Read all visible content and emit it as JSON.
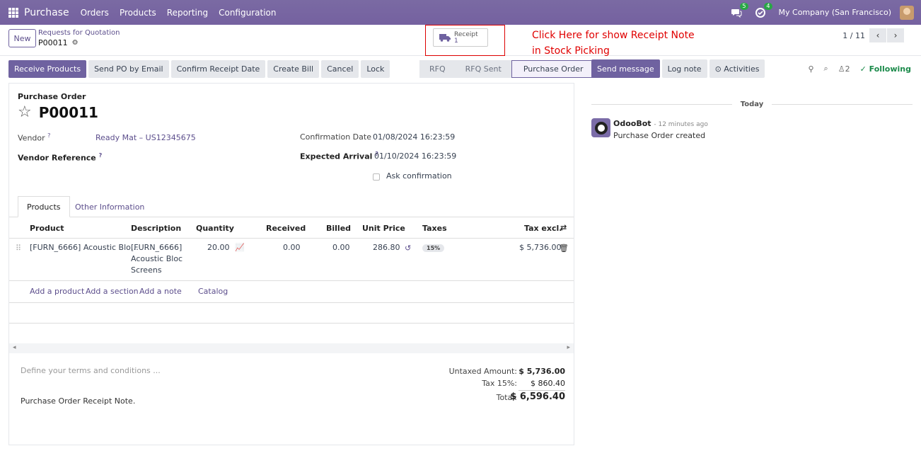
{
  "navbar": {
    "app_name": "Purchase",
    "menus": [
      "Orders",
      "Products",
      "Reporting",
      "Configuration"
    ],
    "messages_count": "5",
    "activities_count": "4",
    "company": "My Company (San Francisco)"
  },
  "control": {
    "new_label": "New",
    "breadcrumb_parent": "Requests for Quotation",
    "breadcrumb_current": "P00011",
    "receipt_label": "Receipt",
    "receipt_count": "1",
    "annotation_line1": "Click Here for show Receipt Note",
    "annotation_line2": "in Stock Picking",
    "pager": "1 / 11"
  },
  "actions": [
    "Receive Products",
    "Send PO by Email",
    "Confirm Receipt Date",
    "Create Bill",
    "Cancel",
    "Lock"
  ],
  "status_steps": [
    "RFQ",
    "RFQ Sent",
    "Purchase Order"
  ],
  "status_active": "Purchase Order",
  "chatter": {
    "send_message": "Send message",
    "log_note": "Log note",
    "activities": "Activities",
    "followers_count": "2",
    "following": "Following",
    "today": "Today",
    "author": "OdooBot",
    "when": "- 12 minutes ago",
    "message": "Purchase Order created"
  },
  "form": {
    "doc_type": "Purchase Order",
    "name": "P00011",
    "vendor_label": "Vendor",
    "vendor_value": "Ready Mat – US12345675",
    "vendor_ref_label": "Vendor Reference",
    "confirmation_label": "Confirmation Date",
    "confirmation_value": "01/08/2024 16:23:59",
    "expected_label": "Expected Arrival",
    "expected_value": "01/10/2024 16:23:59",
    "ask_confirmation": "Ask confirmation",
    "tab_products": "Products",
    "tab_other": "Other Information"
  },
  "table": {
    "headers": {
      "product": "Product",
      "description": "Description",
      "quantity": "Quantity",
      "received": "Received",
      "billed": "Billed",
      "unit_price": "Unit Price",
      "taxes": "Taxes",
      "tax_excl": "Tax excl."
    },
    "row": {
      "product": "[FURN_6666] Acoustic Blo…",
      "desc1": "[FURN_6666]",
      "desc2": "Acoustic Bloc",
      "desc3": "Screens",
      "quantity": "20.00",
      "received": "0.00",
      "billed": "0.00",
      "unit_price": "286.80",
      "tax": "15%",
      "subtotal": "$ 5,736.00"
    },
    "add_product": "Add a product",
    "add_section": "Add a section",
    "add_note": "Add a note",
    "catalog": "Catalog"
  },
  "footer": {
    "terms_placeholder": "Define your terms and conditions ...",
    "note": "Purchase Order Receipt Note.",
    "untaxed_label": "Untaxed Amount:",
    "untaxed_value": "$ 5,736.00",
    "tax_label": "Tax 15%:",
    "tax_value": "$ 860.40",
    "total_label": "Total:",
    "total_value": "$ 6,596.40"
  }
}
